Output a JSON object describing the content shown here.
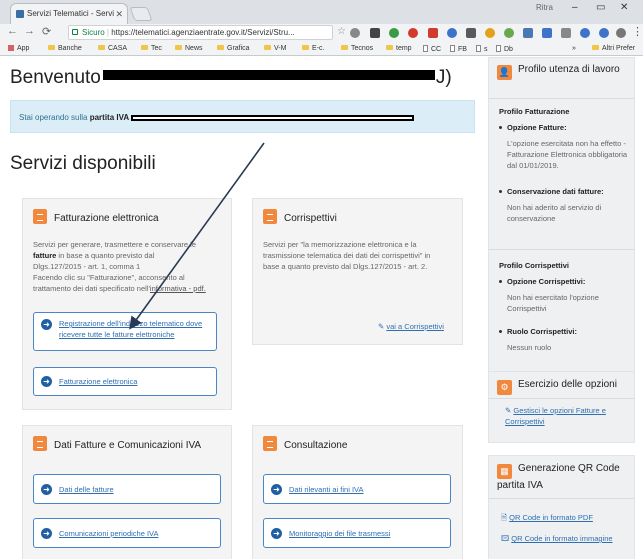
{
  "browser": {
    "tab_title": "Servizi Telematici - Servi",
    "tab_close": "✕",
    "window_user": "Ritra",
    "url_secure_label": "Sicuro",
    "url": "https://telematici.agenziaentrate.gov.it/Servizi/Stru...",
    "bookmarks": [
      "App",
      "Banche",
      "CASA",
      "Tec",
      "News",
      "Grafica",
      "V-M",
      "E-c.",
      "Tecnos",
      "temp",
      "CC",
      "FB",
      "s",
      "Db",
      "»",
      "Altri Prefer"
    ]
  },
  "page": {
    "welcome_prefix": "Benvenuto",
    "welcome_suffix": "J)",
    "alert_prefix": "Stai operando sulla ",
    "alert_bold": "partita IVA",
    "section_title": "Servizi disponibili"
  },
  "panels": {
    "fatturazione": {
      "title": "Fatturazione elettronica",
      "desc_1": "Servizi per generare, trasmettere e conservare le",
      "desc_bold": "fatture",
      "desc_2": " in base a quanto previsto dal",
      "desc_3": "Dlgs.127/2015 - art. 1, comma 1",
      "desc_4": "Facendo clic su \"Fatturazione\", acconsento al",
      "desc_5_prefix": "trattamento dei dati specificato nell'",
      "desc_5_link": "informativa - pdf.",
      "btn_registrazione": "Registrazione dell'indirizzo telematico dove ricevere tutte le fatture elettroniche",
      "btn_fatturazione": "Fatturazione elettronica"
    },
    "corrispettivi": {
      "title": "Corrispettivi",
      "desc_1": "Servizi per \"la memorizzazione elettronica e la",
      "desc_2": "trasmissione telematica dei dati dei corrispettivi\" in",
      "desc_3": "base a quanto previsto dal Dlgs.127/2015 - art. 2.",
      "link": "vai a Corrispettivi"
    },
    "dati_fatture": {
      "title": "Dati Fatture e Comunicazioni IVA",
      "btn_dati": "Dati delle fatture",
      "btn_comunicazioni": "Comunicazioni periodiche IVA"
    },
    "consultazione": {
      "title": "Consultazione",
      "btn_dati_rilevanti": "Dati rilevanti ai fini IVA",
      "btn_monitoraggio": "Monitoraggio dei file trasmessi"
    }
  },
  "sidebar": {
    "profilo": {
      "title": "Profilo utenza di lavoro",
      "fatt_heading": "Profilo Fatturazione",
      "opt_fatture_label": "Opzione Fatture:",
      "opt_fatture_text": "L'opzione esercitata non ha effetto - Fatturazione Elettronica obbligatoria dal 01/01/2019.",
      "conserv_label": "Conservazione dati fatture:",
      "conserv_text": "Non hai aderito al servizio di conservazione",
      "corr_heading": "Profilo Corrispettivi",
      "opt_corr_label": "Opzione Corrispettivi:",
      "opt_corr_text": "Non hai esercitato l'opzione Corrispettivi",
      "ruolo_label": "Ruolo Corrispettivi:",
      "ruolo_text": "Nessun ruolo"
    },
    "opzioni": {
      "title": "Esercizio delle opzioni",
      "link": "Gestisci le opzioni Fatture e Corrispettivi"
    },
    "qr": {
      "title": "Generazione QR Code partita IVA",
      "link_pdf": "QR Code in formato PDF",
      "link_img": "QR Code in formato immagine"
    }
  },
  "colors": {
    "accent_orange": "#f0883e",
    "link_blue": "#2f6fb1",
    "alert_bg": "#dbeef8",
    "arrow": "#2a3a55"
  },
  "icons": {
    "service_button": "arrow-circle-right-icon",
    "panel_header": "document-icon",
    "opzioni": "gear-icon",
    "profilo": "user-icon",
    "qr": "qr-code-icon",
    "edit": "edit-icon"
  }
}
